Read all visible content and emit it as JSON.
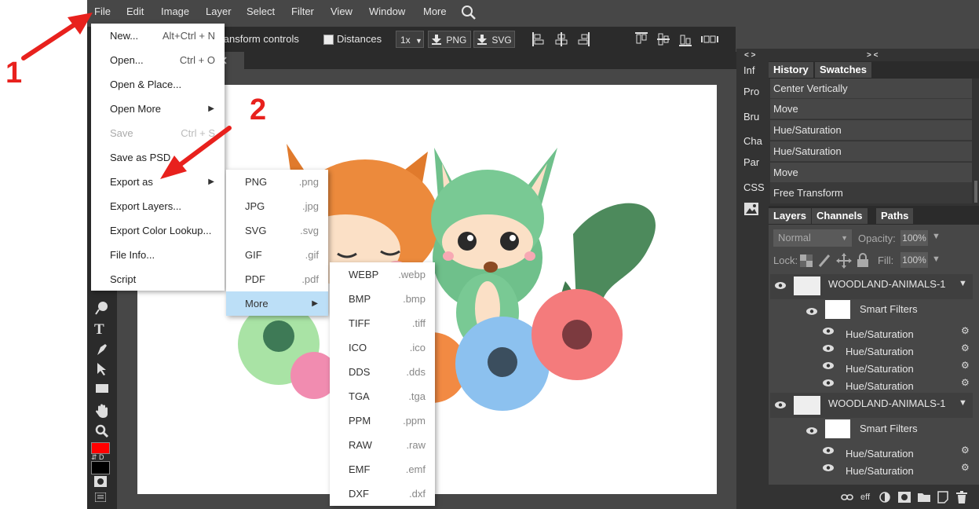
{
  "menubar": {
    "items": [
      "File",
      "Edit",
      "Image",
      "Layer",
      "Select",
      "Filter",
      "View",
      "Window",
      "More"
    ]
  },
  "options_bar": {
    "transform_controls": "Transform controls",
    "distances": "Distances",
    "zoom": "1x",
    "png": "PNG",
    "svg": "SVG"
  },
  "file_menu": [
    {
      "label": "New...",
      "shortcut": "Alt+Ctrl + N"
    },
    {
      "label": "Open...",
      "shortcut": "Ctrl + O"
    },
    {
      "label": "Open & Place...",
      "shortcut": ""
    },
    {
      "label": "Open More",
      "shortcut": "",
      "submenu": true
    },
    {
      "label": "Save",
      "shortcut": "Ctrl + S",
      "disabled": true
    },
    {
      "label": "Save as PSD",
      "shortcut": ""
    },
    {
      "label": "Export as",
      "shortcut": "",
      "submenu": true
    },
    {
      "label": "Export Layers...",
      "shortcut": ""
    },
    {
      "label": "Export Color Lookup...",
      "shortcut": ""
    },
    {
      "label": "File Info...",
      "shortcut": ""
    },
    {
      "label": "Script",
      "shortcut": ""
    }
  ],
  "export_menu": [
    {
      "label": "PNG",
      "ext": ".png"
    },
    {
      "label": "JPG",
      "ext": ".jpg"
    },
    {
      "label": "SVG",
      "ext": ".svg"
    },
    {
      "label": "GIF",
      "ext": ".gif"
    },
    {
      "label": "PDF",
      "ext": ".pdf"
    },
    {
      "label": "More",
      "ext": "",
      "submenu": true
    }
  ],
  "more_menu": [
    {
      "label": "WEBP",
      "ext": ".webp"
    },
    {
      "label": "BMP",
      "ext": ".bmp"
    },
    {
      "label": "TIFF",
      "ext": ".tiff"
    },
    {
      "label": "ICO",
      "ext": ".ico"
    },
    {
      "label": "DDS",
      "ext": ".dds"
    },
    {
      "label": "TGA",
      "ext": ".tga"
    },
    {
      "label": "PPM",
      "ext": ".ppm"
    },
    {
      "label": "RAW",
      "ext": ".raw"
    },
    {
      "label": "EMF",
      "ext": ".emf"
    },
    {
      "label": "DXF",
      "ext": ".dxf"
    }
  ],
  "side_tabs": [
    "Inf",
    "Pro",
    "Bru",
    "Cha",
    "Par",
    "CSS"
  ],
  "collapse_left": "< >",
  "collapse_right": "> <",
  "history_panel": {
    "tabs": [
      "History",
      "Swatches"
    ],
    "items": [
      "Center Vertically",
      "Move",
      "Hue/Saturation",
      "Hue/Saturation",
      "Move",
      "Free Transform"
    ]
  },
  "layers_panel": {
    "tabs": [
      "Layers",
      "Channels",
      "Paths"
    ],
    "blend_mode": "Normal",
    "opacity_label": "Opacity:",
    "opacity_value": "100%",
    "lock_label": "Lock:",
    "fill_label": "Fill:",
    "fill_value": "100%",
    "layer1_name": "WOODLAND-ANIMALS-1",
    "layer2_name": "WOODLAND-ANIMALS-1",
    "smart_filters": "Smart Filters",
    "filter_name": "Hue/Saturation",
    "footer_eff": "eff"
  },
  "annotations": {
    "one": "1",
    "two": "2"
  },
  "colors": {
    "app_bg": "#474747",
    "dark_bg": "#2b2b2b",
    "panel_bg": "#333333",
    "menu_highlight": "#bcdff7",
    "annotation_red": "#e8211d",
    "foreground_color": "#ff0000",
    "background_color": "#000000"
  }
}
